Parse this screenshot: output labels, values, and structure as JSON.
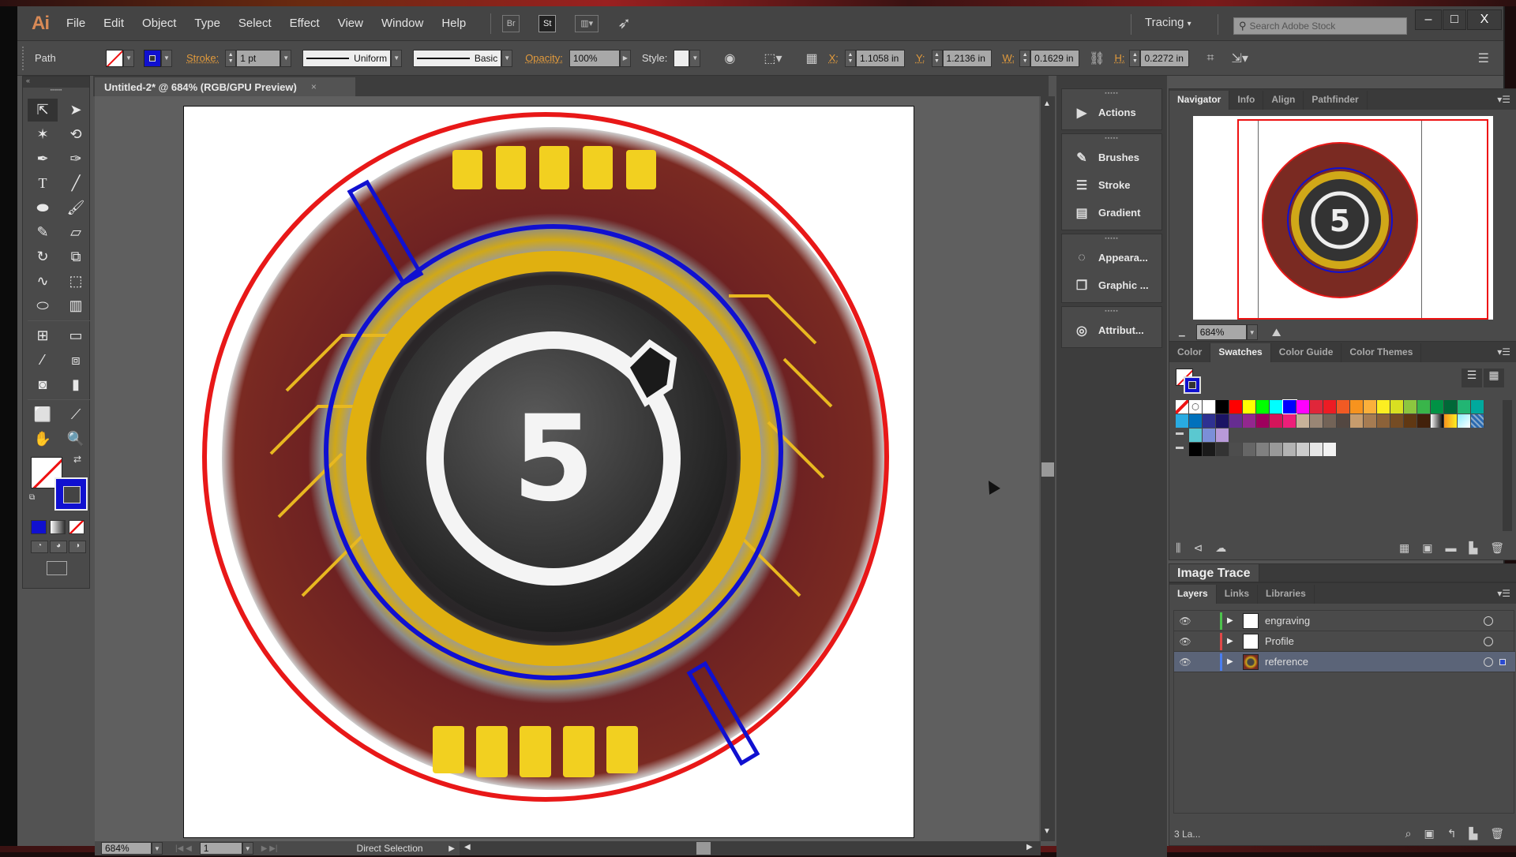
{
  "app": {
    "logo": "Ai",
    "menu": [
      "File",
      "Edit",
      "Object",
      "Type",
      "Select",
      "Effect",
      "View",
      "Window",
      "Help"
    ],
    "bridge_label": "Br",
    "stock_label": "St",
    "workspace": "Tracing",
    "workspace_arrow": "▾",
    "stock_search_placeholder": "Search Adobe Stock",
    "window_controls": {
      "minimize": "–",
      "maximize": "□",
      "close": "X"
    }
  },
  "control_bar": {
    "selection_type": "Path",
    "stroke_label": "Stroke:",
    "stroke_weight": "1 pt",
    "variable_width": "Uniform",
    "brush_def": "Basic",
    "opacity_label": "Opacity:",
    "opacity_value": "100%",
    "style_label": "Style:",
    "x_label": "X:",
    "x_value": "1.1058 in",
    "y_label": "Y:",
    "y_value": "1.2136 in",
    "w_label": "W:",
    "w_value": "0.1629 in",
    "h_label": "H:",
    "h_value": "0.2272 in"
  },
  "document": {
    "tab_title": "Untitled-2* @ 684% (RGB/GPU Preview)",
    "close": "×",
    "artwork_number": "5"
  },
  "status_bar": {
    "zoom": "684%",
    "artboard": "1",
    "current_tool": "Direct Selection"
  },
  "icon_panels": [
    [
      {
        "icon": "play-icon",
        "glyph": "▶",
        "label": "Actions"
      }
    ],
    [
      {
        "icon": "brushes-icon",
        "glyph": "✎",
        "label": "Brushes"
      },
      {
        "icon": "stroke-icon",
        "glyph": "☰",
        "label": "Stroke"
      },
      {
        "icon": "gradient-icon",
        "glyph": "▤",
        "label": "Gradient"
      }
    ],
    [
      {
        "icon": "appearance-icon",
        "glyph": "◌",
        "label": "Appeara..."
      },
      {
        "icon": "graphic-styles-icon",
        "glyph": "❐",
        "label": "Graphic ..."
      }
    ],
    [
      {
        "icon": "attributes-icon",
        "glyph": "◎",
        "label": "Attribut..."
      }
    ]
  ],
  "navigator_panel": {
    "tabs": [
      "Navigator",
      "Info",
      "Align",
      "Pathfinder"
    ],
    "active_tab": "Navigator",
    "zoom": "684%"
  },
  "swatches_panel": {
    "tabs": [
      "Color",
      "Swatches",
      "Color Guide",
      "Color Themes"
    ],
    "active_tab": "Swatches",
    "row1": [
      "none",
      "registration",
      "#ffffff",
      "#000000",
      "#ff0000",
      "#ffff00",
      "#00ff00",
      "#00ffff",
      "#0000ff",
      "#ff00ff",
      "#e0263a",
      "#ed1c24",
      "#f15a24",
      "#f7931e",
      "#fbb03b",
      "#fcee21",
      "#d9e021",
      "#8cc63f",
      "#39b54a",
      "#009245",
      "#006837",
      "#22b573",
      "#00a99d"
    ],
    "row2": [
      "#29abe2",
      "#0071bc",
      "#2e3192",
      "#1b1464",
      "#662d91",
      "#93278f",
      "#9e005d",
      "#d4145a",
      "#ed1e79",
      "#c7b299",
      "#998675",
      "#736357",
      "#534741",
      "#c69c6d",
      "#a67c52",
      "#8c6239",
      "#754c24",
      "#603813",
      "#42210b",
      "gradient-bw",
      "gradient-orange",
      "pattern-cyan",
      "pattern-blue"
    ],
    "group1": [
      "#5ac8d0",
      "#7b8fd8",
      "#b89ad8"
    ],
    "group2": [
      "#000000",
      "#1a1a1a",
      "#333333",
      "#4d4d4d",
      "#666666",
      "#808080",
      "#999999",
      "#b3b3b3",
      "#cccccc",
      "#e6e6e6",
      "#f2f2f2"
    ]
  },
  "image_trace_panel": {
    "title": "Image Trace"
  },
  "layers_panel": {
    "tabs": [
      "Layers",
      "Links",
      "Libraries"
    ],
    "active_tab": "Layers",
    "layers": [
      {
        "name": "engraving",
        "color": "#4cc24c",
        "selected": false
      },
      {
        "name": "Profile",
        "color": "#e04848",
        "selected": false
      },
      {
        "name": "reference",
        "color": "#4a7ef0",
        "selected": true
      }
    ],
    "count_label": "3 La..."
  },
  "colors": {
    "selection_blue": "#1010d0",
    "outer_circle_red": "#e81818",
    "accent_orange": "#e19a3c"
  }
}
